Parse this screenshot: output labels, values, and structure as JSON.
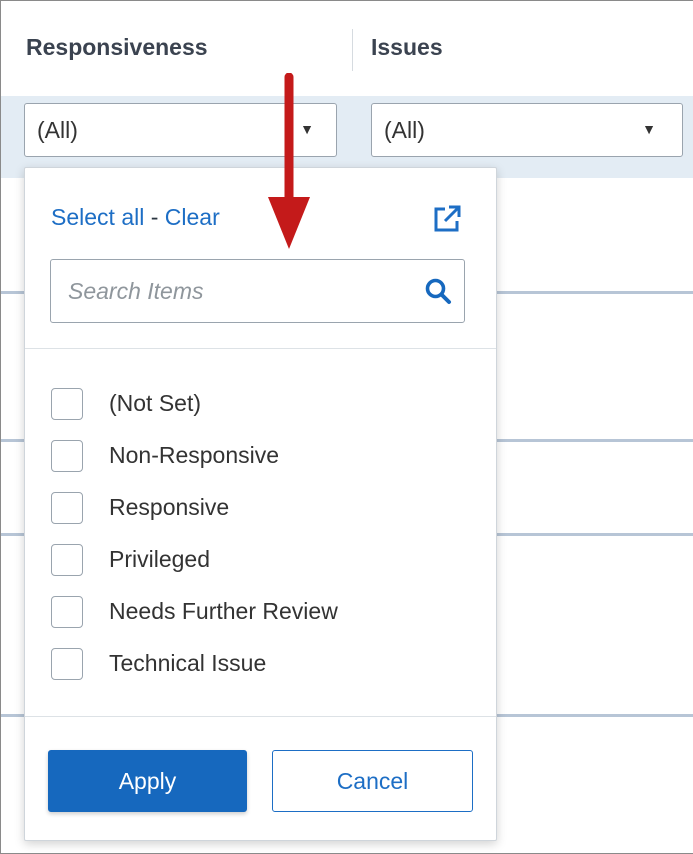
{
  "columns": {
    "responsiveness_title": "Responsiveness",
    "issues_title": "Issues"
  },
  "filters": {
    "responsiveness_value": "(All)",
    "issues_value": "(All)"
  },
  "dropdown": {
    "select_all_label": "Select all",
    "separator": " - ",
    "clear_label": "Clear",
    "search_placeholder": "Search Items",
    "items": [
      {
        "label": "(Not Set)",
        "checked": false
      },
      {
        "label": "Non-Responsive",
        "checked": false
      },
      {
        "label": "Responsive",
        "checked": false
      },
      {
        "label": "Privileged",
        "checked": false
      },
      {
        "label": "Needs Further Review",
        "checked": false
      },
      {
        "label": "Technical Issue",
        "checked": false
      }
    ],
    "apply_label": "Apply",
    "cancel_label": "Cancel"
  },
  "icons": {
    "popout": "external-link-icon",
    "search": "search-icon",
    "caret": "caret-down-icon",
    "annotation": "red-arrow-annotation"
  },
  "colors": {
    "accent": "#1668be",
    "link": "#1d6ec5",
    "filter_row_bg": "#e3ecf4",
    "annotation_arrow": "#c41a1a"
  }
}
